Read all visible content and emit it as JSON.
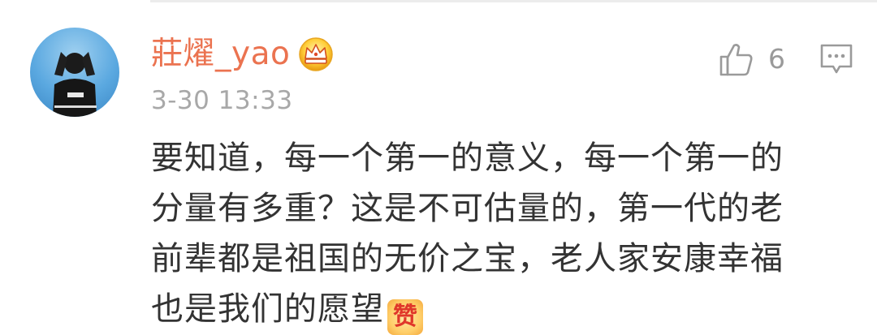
{
  "comment": {
    "author": {
      "name": "莊燿_yao",
      "badge_icon": "crown-icon",
      "avatar_icon": "avatar"
    },
    "timestamp": "3-30 13:33",
    "likes": {
      "icon": "thumbs-up-icon",
      "count": "6"
    },
    "reply": {
      "icon": "comment-reply-icon"
    },
    "body_lines": [
      "要知道，每一个第一的意义，每一个第一的",
      "分量有多重？这是不可估量的，第一代的老",
      "前辈都是祖国的无价之宝，老人家安康幸福",
      "也是我们的愿望"
    ],
    "emoji": {
      "icon": "zan-emoji",
      "text": "赞"
    }
  },
  "colors": {
    "username": "#eb7350",
    "timestamp": "#a8a8a8",
    "body_text": "#333333",
    "icon_gray": "#9a9a9a"
  }
}
